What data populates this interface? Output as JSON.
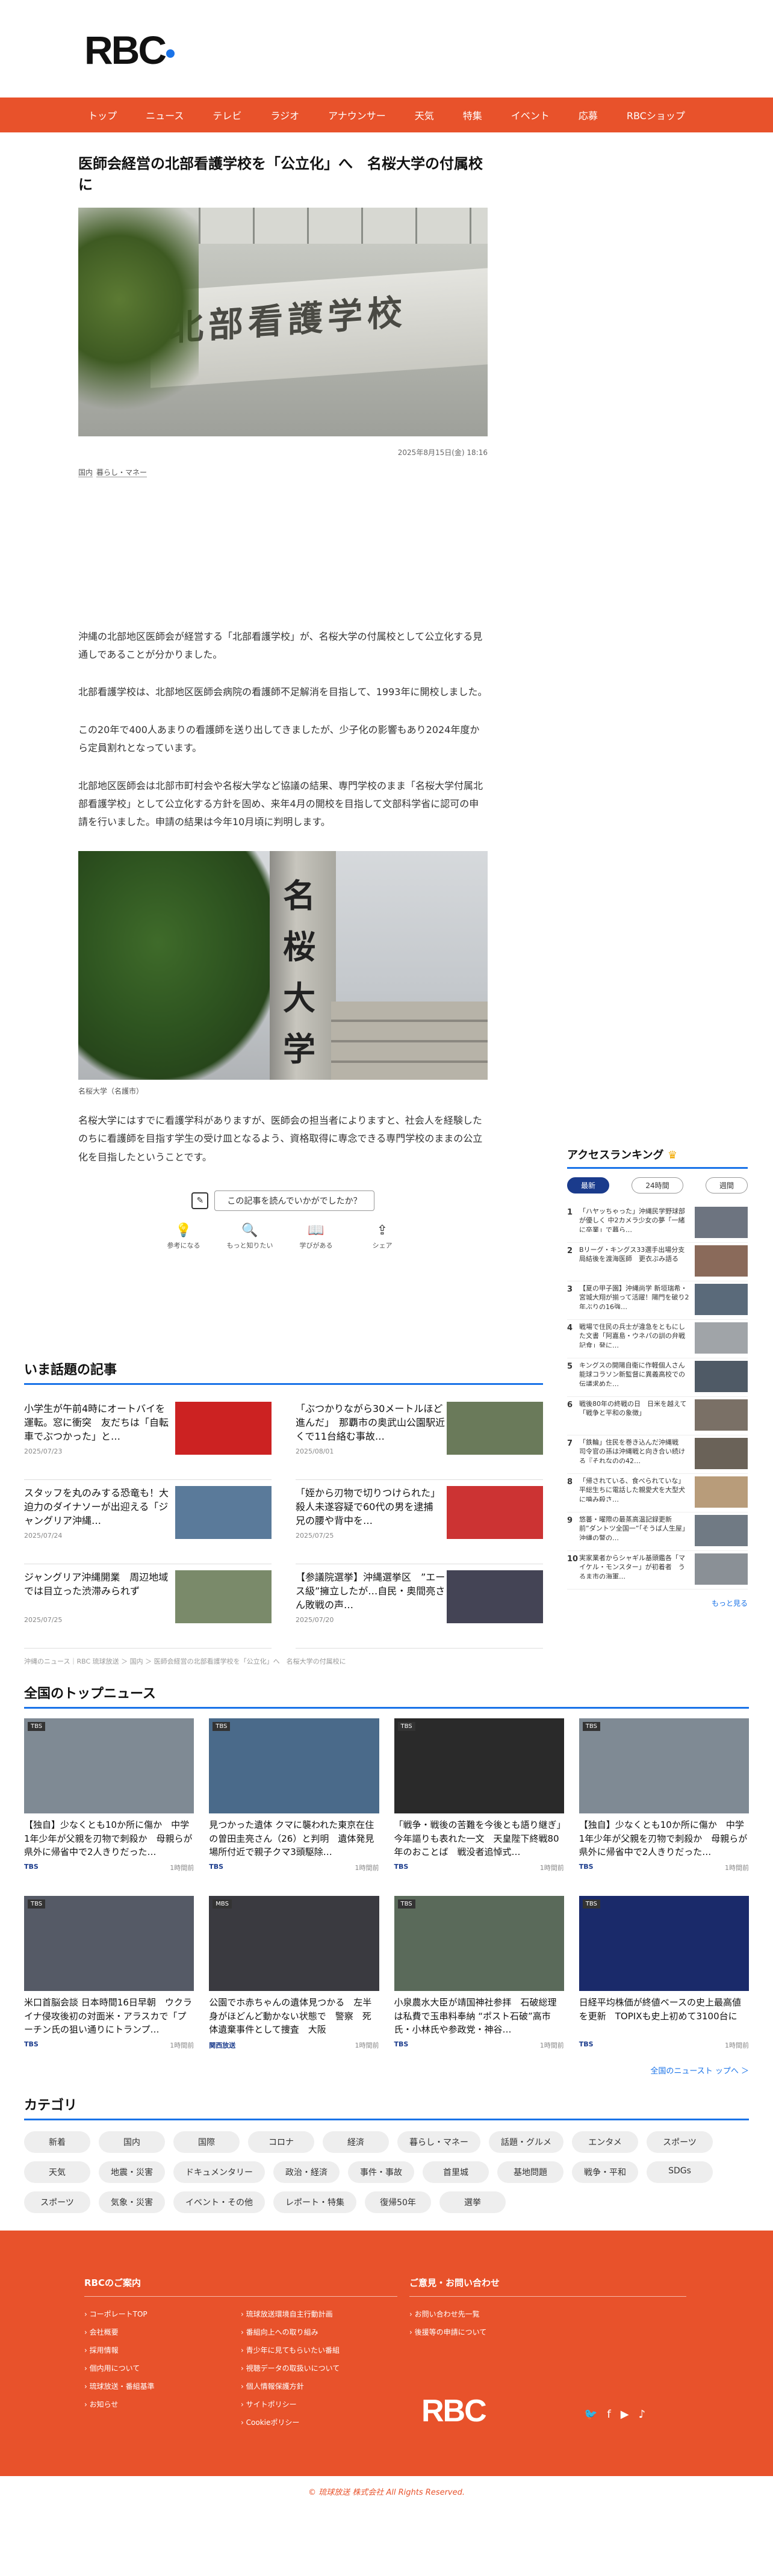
{
  "brand": {
    "logo": "RBC",
    "accent": "#e8522b",
    "blue": "#1a73e8"
  },
  "nav": [
    "トップ",
    "ニュース",
    "テレビ",
    "ラジオ",
    "アナウンサー",
    "天気",
    "特集",
    "イベント",
    "応募",
    "RBCショップ"
  ],
  "article": {
    "title": "医師会経営の北部看護学校を「公立化」へ　名桜大学の付属校に",
    "hero_sign": "北部看護学校",
    "date": "2025年8月15日(金) 18:16",
    "tags": [
      "国内",
      "暮らし・マネー"
    ],
    "paragraphs": [
      "沖縄の北部地区医師会が経営する「北部看護学校」が、名桜大学の付属校として公立化する見通しであることが分かりました。",
      "北部看護学校は、北部地区医師会病院の看護師不足解消を目指して、1993年に開校しました。",
      "この20年で400人あまりの看護師を送り出してきましたが、少子化の影響もあり2024年度から定員割れとなっています。",
      "北部地区医師会は北部市町村会や名桜大学など協議の結果、専門学校のまま「名桜大学付属北部看護学校」として公立化する方針を固め、来年4月の開校を目指して文部科学省に認可の申請を行いました。申請の結果は今年10月頃に判明します。"
    ],
    "image2_sign": [
      "名",
      "桜",
      "大",
      "学"
    ],
    "caption": "名桜大学（名護市）",
    "after": "名桜大学にはすでに看護学科がありますが、医師会の担当者によりますと、社会人を経験したのちに看護師を目指す学生の受け皿となるよう、資格取得に専念できる専門学校のままの公立化を目指したということです。",
    "survey_question": "この記事を読んでいかがでしたか？",
    "reactions": [
      {
        "icon": "lightbulb-icon",
        "glyph": "💡",
        "label": "参考になる"
      },
      {
        "icon": "magnifier-icon",
        "glyph": "🔍",
        "label": "もっと知りたい"
      },
      {
        "icon": "book-icon",
        "glyph": "📖",
        "label": "学びがある"
      },
      {
        "icon": "share-icon",
        "glyph": "⇪",
        "label": "シェア"
      }
    ]
  },
  "ranking": {
    "title": "アクセスランキング",
    "tabs": [
      "最新",
      "24時間",
      "週間"
    ],
    "items": [
      "「ハヤッちゃった」沖縄民学野球部が優しく 中2カメラ少女の夢「一緒に卒業」で暮ら…",
      "Bリーグ・キングス33選手出場分支局結後を渡海医師　更衣ぶみ語る",
      "【夏の甲子園】沖縄尚学 新垣瑞希・宮城大翔が揃って活躍！陽門を破り2年ぶりの16強…",
      "戦場で住民の兵士が違急をともにした文書「阿嘉島・ウネパの訓の弁戦記食」発に…",
      "キングスの開陽自衛に作軽個人さん　能球コラソン新監督に異義高校での伝議求めた…",
      "戦後80年の終戦の日　日米を越えて「戦争と平和の象徴」",
      "「鉄輪」住民を巻き込んだ沖縄戦　司令官の孫は沖縄戦と向き合い続ける『それなのの42…",
      "「帰されている、食べられていな」平総生ちに電話した親愛犬を大型犬に噛み殺さ…",
      "悠蕃・曜際の最蒸高温記録更新　前”ダントツ全国一”「そうば人生屋」沖縄の警の…",
      "実家業者からシャギル基頭鑑各「マイケル・モンスター」が初着者　うるま市の海軍…"
    ],
    "more": "もっと見る"
  },
  "hot": {
    "title": "いま話題の記事",
    "items": [
      {
        "headline": "小学生が午前4時にオートバイを運転。窓に衝突　友だちは「自転車でぶつかった」と…",
        "date": "2025/07/23"
      },
      {
        "headline": "「ぶつかりながら30メートルほど進んだ」　那覇市の奥武山公園駅近くで11台絡む事故…",
        "date": "2025/08/01"
      },
      {
        "headline": "スタッフを丸のみする恐竜も！大迫力のダイナソーが出迎える「ジャングリア沖縄…",
        "date": "2025/07/24"
      },
      {
        "headline": "「姪から刃物で切りつけられた」殺人未遂容疑で60代の男を逮捕　兄の腰や背中を…",
        "date": "2025/07/25"
      },
      {
        "headline": "ジャングリア沖縄開業　周辺地域では目立った渋滞みられず",
        "date": "2025/07/25"
      },
      {
        "headline": "【参議院選挙】沖縄選挙区　”エース級”擁立したが…自民・奥間亮さん敗戦の声…",
        "date": "2025/07/20"
      }
    ]
  },
  "crumb": "沖縄のニュース｜RBC 琉球放送 ＞ 国内 ＞ 医師会経営の北部看護学校を「公立化」へ　名桜大学の付属校に",
  "top": {
    "title": "全国のトップニュース",
    "cards": [
      {
        "headline": "【独自】少なくとも10か所に傷か　中学1年少年が父親を刃物で刺殺か　母親らが県外に帰省中で2人きりだった…",
        "src": "TBS",
        "ago": "1時間前",
        "badge": "TBS"
      },
      {
        "headline": "見つかった遺体 クマに襲われた東京在住の曽田圭亮さん（26）と判明　遺体発見場所付近で親子クマ3頭駆除…",
        "src": "TBS",
        "ago": "1時間前",
        "badge": "TBS"
      },
      {
        "headline": "「戦争・戦後の苦難を今後とも語り継ぎ」今年謳りも表れた一文　天皇陛下終戦80年のおことば　戦没者追悼式…",
        "src": "TBS",
        "ago": "1時間前",
        "badge": "TBS"
      },
      {
        "headline": "【独自】少なくとも10か所に傷か　中学1年少年が父親を刃物で刺殺か　母親らが県外に帰省中で2人きりだった…",
        "src": "TBS",
        "ago": "1時間前",
        "badge": "TBS"
      },
      {
        "headline": "米口首脳会談 日本時間16日早朝　ウクライナ侵攻後初の対面米・アラスカで「プーチン氏の狙い通りにトランプ…",
        "src": "TBS",
        "ago": "1時間前",
        "badge": "TBS"
      },
      {
        "headline": "公園でホ赤ちゃんの遺体見つかる　左半身がほどんど動かない状態で　警察　死体遺棄事件として捜査　大阪",
        "src": "関西放送",
        "ago": "1時間前",
        "badge": "MBS"
      },
      {
        "headline": "小泉農水大臣が靖国神社参拝　石破総理は私費で玉串料奉納 “ポスト石破”高市氏・小林氏や参政党・神谷…",
        "src": "TBS",
        "ago": "1時間前",
        "badge": "TBS"
      },
      {
        "headline": "日経平均株価が終値ベースの史上最高値を更新　TOPIXも史上初めて3100台に",
        "src": "TBS",
        "ago": "1時間前",
        "badge": "TBS"
      }
    ],
    "all": "全国のニュースト ップへ ＞"
  },
  "category": {
    "title": "カテゴリ",
    "pills": [
      "新着",
      "国内",
      "国際",
      "コロナ",
      "経済",
      "暮らし・マネー",
      "話題・グルメ",
      "エンタメ",
      "スポーツ",
      "天気",
      "地震・災害",
      "ドキュメンタリー",
      "政治・経済",
      "事件・事故",
      "首里城",
      "基地問題",
      "戦争・平和",
      "SDGs",
      "スポーツ",
      "気象・災害",
      "イベント・その他",
      "レポート・特集",
      "復帰50年",
      "選挙"
    ]
  },
  "footer": {
    "col1_title": "RBCのご案内",
    "col1_left": [
      "コーポレートTOP",
      "会社概要",
      "採用情報",
      "個内用について",
      "琉球放送・番組基準",
      "お知らせ"
    ],
    "col1_right": [
      "琉球放送環境自主行動計画",
      "番組向上への取り組み",
      "青少年に見てもらいたい番組",
      "視聴データの取扱いについて",
      "個人情報保護方針",
      "サイトポリシー",
      "Cookieポリシー"
    ],
    "col2_title": "ご意見・お問い合わせ",
    "col2_items": [
      "お問い合わせ先一覧",
      "後援等の申請について"
    ],
    "logo": "RBC",
    "social": [
      "twitter-icon",
      "facebook-icon",
      "youtube-icon",
      "tiktok-icon"
    ],
    "copyright": "© 琉球放送 株式会社 All Rights Reserved."
  }
}
